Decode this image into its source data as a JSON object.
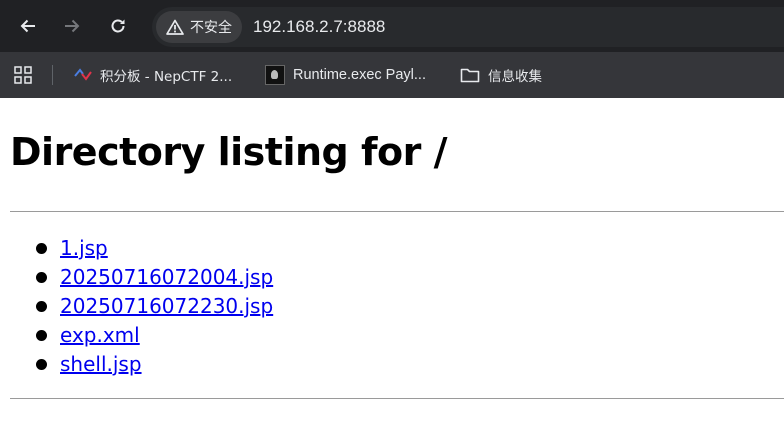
{
  "browser": {
    "security_label": "不安全",
    "url": "192.168.2.7:8888"
  },
  "bookmarks": [
    {
      "label": "积分板 - NepCTF 2...",
      "icon": "ctf-favicon"
    },
    {
      "label": "Runtime.exec Payl...",
      "icon": "image-favicon"
    },
    {
      "label": "信息收集",
      "icon": "folder-icon"
    }
  ],
  "page": {
    "heading": "Directory listing for /",
    "files": [
      "1.jsp",
      "20250716072004.jsp",
      "20250716072230.jsp",
      "exp.xml",
      "shell.jsp"
    ]
  }
}
